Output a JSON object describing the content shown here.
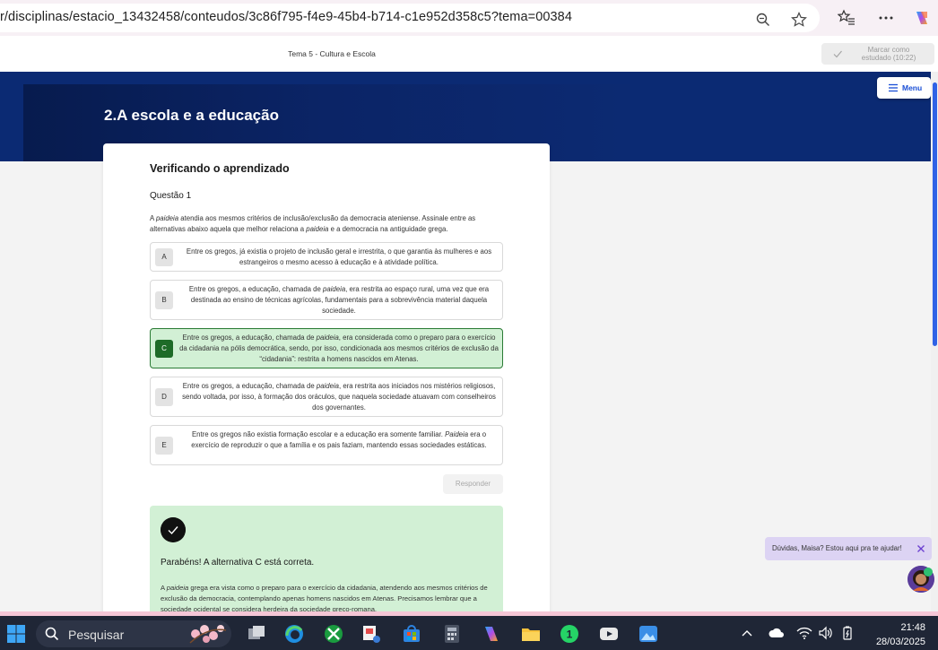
{
  "browser": {
    "url": "r/disciplinas/estacio_13432458/conteudos/3c86f795-f4e9-45b4-b714-c1e952d358c5?tema=00384",
    "icons": [
      "zoom-icon",
      "favorite-star-icon",
      "favorites-list-icon",
      "more-icon",
      "copilot-icon"
    ]
  },
  "header": {
    "tema_title": "Tema 5 - Cultura e Escola",
    "mark_line1": "Marcar como",
    "mark_line2": "estudado (10:22)"
  },
  "banner": {
    "title": "2.A escola e a educação",
    "menu_label": "Menu"
  },
  "card": {
    "title": "Verificando o aprendizado",
    "question_no": "Questão 1",
    "question_text_1": "A ",
    "question_text_italic_1": "paideia",
    "question_text_2": " atendia aos mesmos critérios de inclusão/exclusão da democracia ateniense. Assinale entre as alternativas abaixo aquela que melhor relaciona a ",
    "question_text_italic_2": "paideia",
    "question_text_3": " e a democracia na antiguidade grega.",
    "options": [
      {
        "letter": "A",
        "text": "Entre os gregos, já existia o projeto de inclusão geral e irrestrita, o que garantia às mulheres e aos estrangeiros o mesmo acesso à educação e à atividade política."
      },
      {
        "letter": "B",
        "pre": "Entre os gregos, a educação, chamada de ",
        "italic": "paideia",
        "post": ", era restrita ao espaço rural, uma vez que era destinada ao ensino de técnicas agrícolas, fundamentais para a sobrevivência material daquela sociedade."
      },
      {
        "letter": "C",
        "pre": "Entre os gregos, a educação, chamada de ",
        "italic": "paideia",
        "post": ", era considerada como o preparo para o exercício da cidadania na pólis democrática, sendo, por isso, condicionada aos mesmos critérios de exclusão da “cidadania”: restrita a homens nascidos em Atenas."
      },
      {
        "letter": "D",
        "pre": "Entre os gregos, a educação, chamada de ",
        "italic": "paideia",
        "post": ", era restrita aos iniciados nos mistérios religiosos, sendo voltada, por isso, à formação dos oráculos, que naquela sociedade atuavam com conselheiros dos governantes."
      },
      {
        "letter": "E",
        "pre": "Entre os gregos não existia formação escolar e a educação era somente familiar. ",
        "italic": "Paideia",
        "post": " era o exercício de reproduzir o que a família e os pais faziam, mantendo essas sociedades estáticas."
      }
    ],
    "respond_label": "Responder",
    "feedback_title": "Parabéns! A alternativa C está correta.",
    "feedback_pre": "A ",
    "feedback_italic": "paideia",
    "feedback_post": " grega era vista como o preparo para o exercício da cidadania, atendendo aos mesmos critérios de exclusão da democracia, contemplando apenas homens nascidos em Atenas. Precisamos lembrar que a sociedade ocidental se considera herdeira da sociedade greco-romana."
  },
  "chat": {
    "text": "Dúvidas, Maisa? Estou aqui pra te ajudar!"
  },
  "taskbar": {
    "search_label": "Pesquisar",
    "time": "21:48",
    "date": "28/03/2025"
  },
  "colors": {
    "accent_blue": "#2f62e6",
    "banner_blue": "#0b2a73",
    "correct_green": "#1e6b28",
    "correct_bg": "#d2f0d5"
  }
}
